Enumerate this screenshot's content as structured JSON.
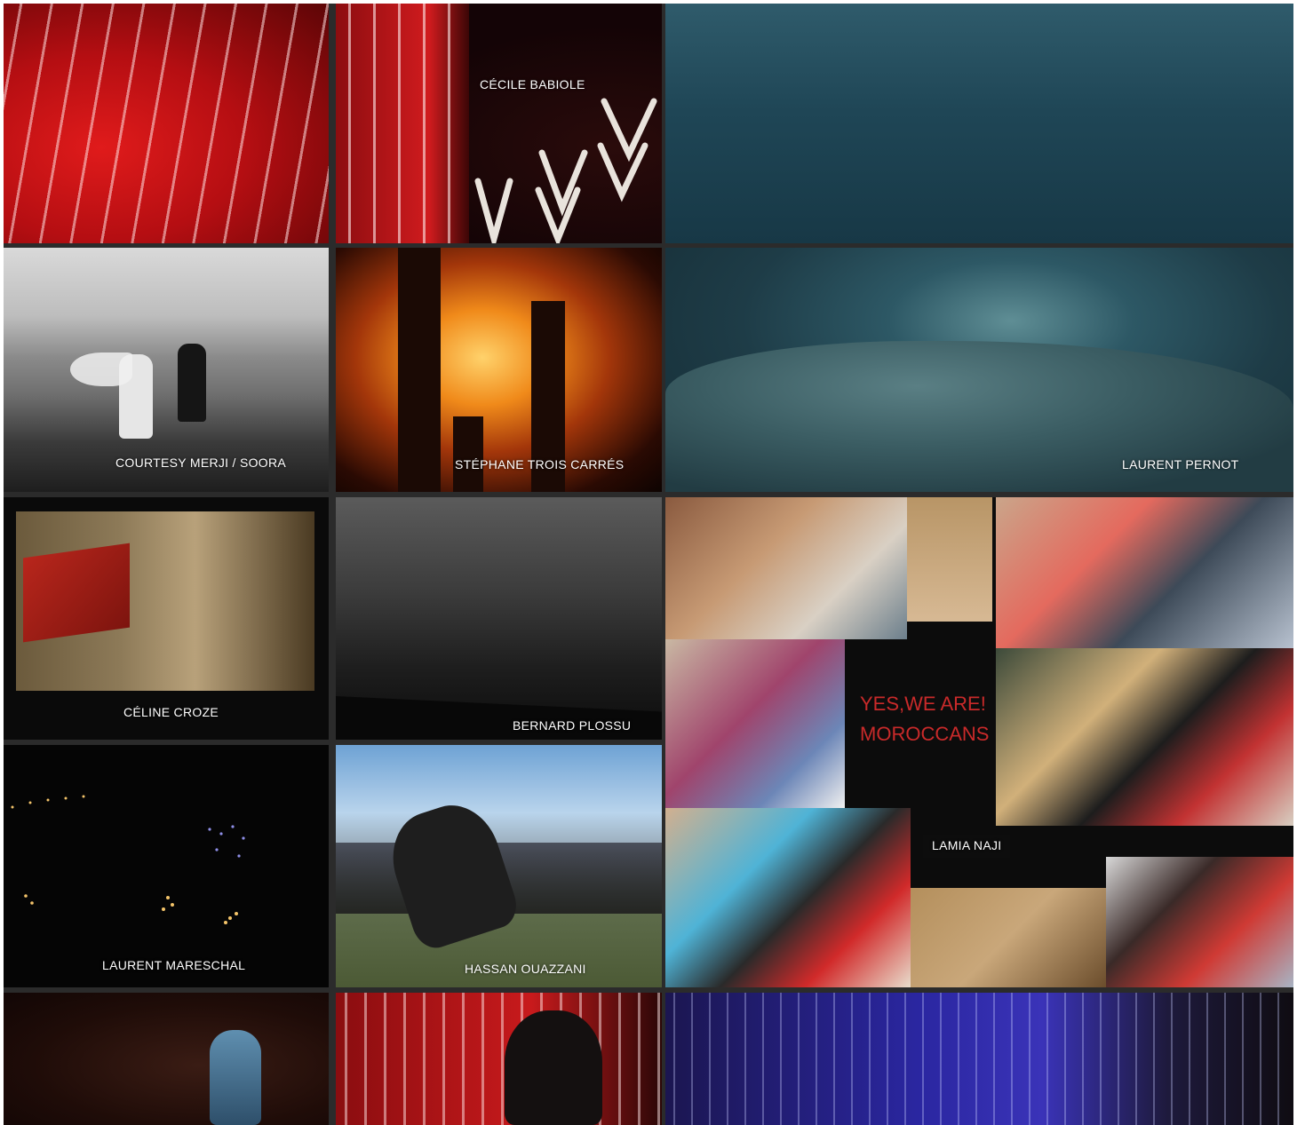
{
  "captions": {
    "cecile_babiole": "CÉCILE BABIOLE",
    "courtesy_merji_soora": "COURTESY MERJI / SOORA",
    "stephane_trois_carres": "STÉPHANE TROIS CARRÉS",
    "laurent_pernot": "LAURENT PERNOT",
    "celine_croze": "CÉLINE CROZE",
    "bernard_plossu": "BERNARD PLOSSU",
    "lamia_naji": "LAMIA NAJI",
    "laurent_mareschal": "LAURENT MARESCHAL",
    "hassan_ouazzani": "HASSAN OUAZZANI"
  },
  "collage_text": {
    "line1": "YES,WE ARE!",
    "line2": "MOROCCANS"
  },
  "colors": {
    "gutter": "#2b2b2b",
    "caption_text": "#ffffff",
    "collage_red": "#c92a2a"
  }
}
